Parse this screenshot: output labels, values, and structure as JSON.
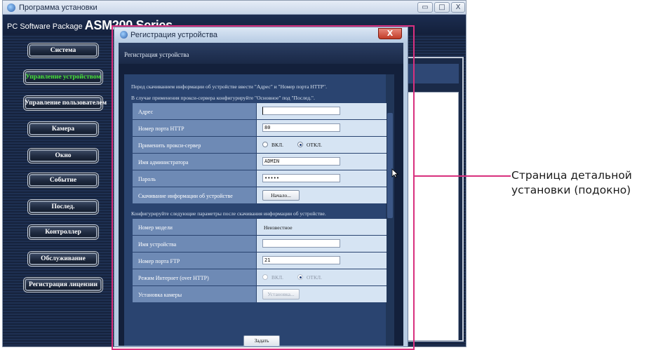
{
  "app": {
    "title": "Программа установки",
    "brand_prefix": "PC Software Package ",
    "brand_name": "ASM200 Series"
  },
  "window_controls": {
    "minimize": "▭",
    "maximize": "□",
    "close": "X"
  },
  "menu": {
    "items": [
      {
        "label": "Система"
      },
      {
        "label": "Управление устройством",
        "active": true
      },
      {
        "label": "Управление пользователем"
      },
      {
        "label": "Камера"
      },
      {
        "label": "Окно"
      },
      {
        "label": "Событие"
      },
      {
        "label": "Послед."
      },
      {
        "label": "Контроллер"
      },
      {
        "label": "Обслуживание"
      },
      {
        "label": "Регистрация лицензии"
      }
    ]
  },
  "dialog": {
    "title": "Регистрация устройства",
    "close_label": "X",
    "heading": "Регистрация устройства",
    "note1": "Перед скачиванием информации об устройстве ввести \"Адрес\" и \"Номер порта HTTP\".",
    "note2": "В случае применения прокси-сервера конфигурируйте \"Основное\" под \"Послед.\".",
    "section1": {
      "address": {
        "label": "Адрес",
        "value": ""
      },
      "http_port": {
        "label": "Номер порта HTTP",
        "value": "80"
      },
      "proxy": {
        "label": "Применить прокси-сервер",
        "on": "ВКЛ.",
        "off": "ОТКЛ.",
        "selected": "off"
      },
      "admin": {
        "label": "Имя администратора",
        "value": "ADMIN"
      },
      "password": {
        "label": "Пароль",
        "value": "•••••"
      },
      "download": {
        "label": "Скачивание информации об устройстве",
        "button": "Начало..."
      }
    },
    "note3": "Конфигурируйте следующие параметры после скачивания информации об устройстве.",
    "section2": {
      "model": {
        "label": "Номер модели",
        "value": "Неизвестное"
      },
      "device_name": {
        "label": "Имя устройства",
        "value": ""
      },
      "ftp_port": {
        "label": "Номер порта FTP",
        "value": "21"
      },
      "internet": {
        "label": "Режим Интернет (over HTTP)",
        "on": "ВКЛ.",
        "off": "ОТКЛ.",
        "selected": "off"
      },
      "camera": {
        "label": "Установка камеры",
        "button": "Установка..."
      }
    },
    "apply_button": "Задать"
  },
  "callout": {
    "line1": "Страница детальной",
    "line2": "установки (подокно)"
  },
  "colors": {
    "highlight": "#d8307e",
    "active_menu": "#47e23c"
  }
}
